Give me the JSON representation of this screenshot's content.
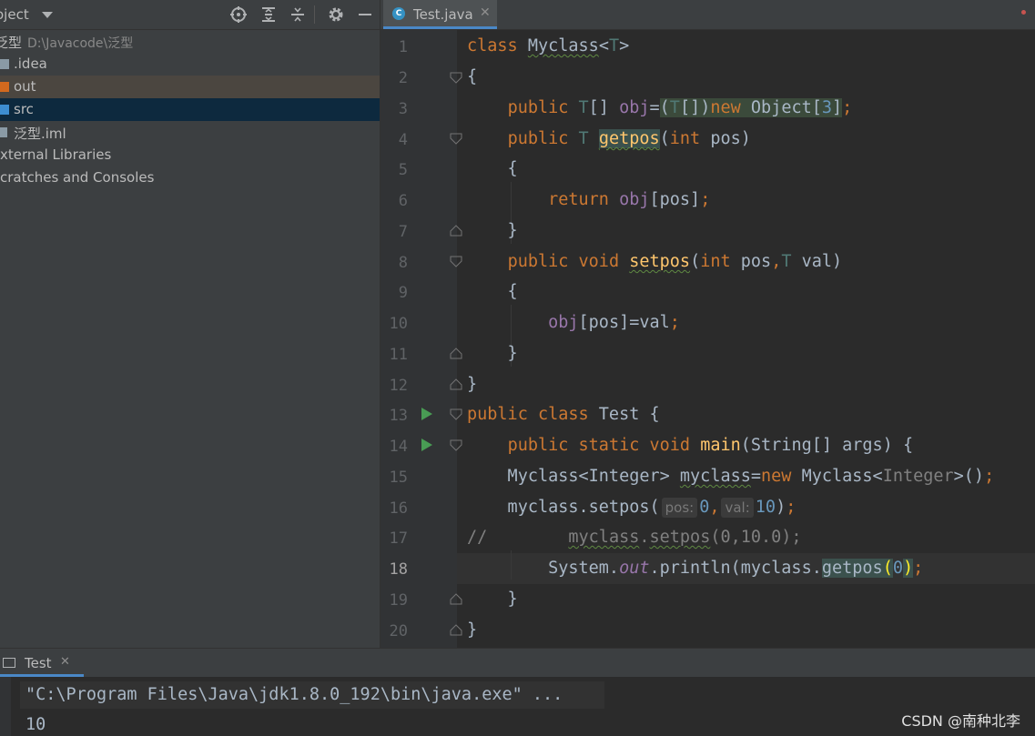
{
  "project": {
    "title": "oject",
    "root_name": "泛型",
    "root_path": "D:\\Javacode\\泛型",
    "items": [
      {
        "label": ".idea"
      },
      {
        "label": "out"
      },
      {
        "label": "src"
      },
      {
        "label": "泛型.iml"
      },
      {
        "label": "xternal Libraries"
      },
      {
        "label": "cratches and Consoles"
      }
    ]
  },
  "editor": {
    "tab_label": "Test.java",
    "tab_icon": "C",
    "line_numbers": [
      "1",
      "2",
      "3",
      "4",
      "5",
      "6",
      "7",
      "8",
      "9",
      "10",
      "11",
      "12",
      "13",
      "14",
      "15",
      "16",
      "17",
      "18",
      "19",
      "20"
    ],
    "current_line": "18",
    "hints": {
      "pos": "pos:",
      "val": "val:"
    }
  },
  "run": {
    "tab_label": "Test",
    "command": "\"C:\\Program Files\\Java\\jdk1.8.0_192\\bin\\java.exe\" ...",
    "output": "10"
  },
  "watermark": "CSDN @南种北李",
  "colors": {
    "accent": "#4a88c7",
    "keyword": "#cc7832",
    "function": "#ffc66d",
    "number": "#6897bb",
    "run_green": "#499c54"
  }
}
